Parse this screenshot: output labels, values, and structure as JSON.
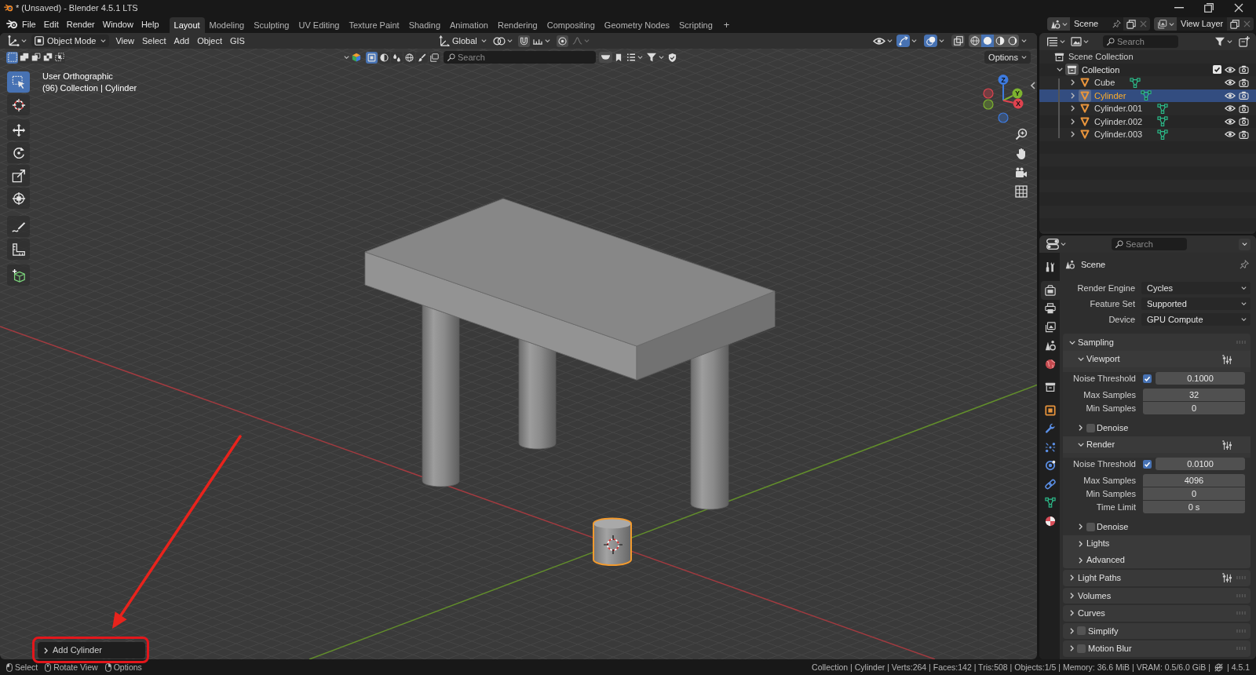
{
  "window": {
    "title": "* (Unsaved) - Blender 4.5.1 LTS"
  },
  "menu_bar": [
    "File",
    "Edit",
    "Render",
    "Window",
    "Help"
  ],
  "workspace_tabs": [
    {
      "label": "Layout",
      "selected": true
    },
    {
      "label": "Modeling",
      "selected": false
    },
    {
      "label": "Sculpting",
      "selected": false
    },
    {
      "label": "UV Editing",
      "selected": false
    },
    {
      "label": "Texture Paint",
      "selected": false
    },
    {
      "label": "Shading",
      "selected": false
    },
    {
      "label": "Animation",
      "selected": false
    },
    {
      "label": "Rendering",
      "selected": false
    },
    {
      "label": "Compositing",
      "selected": false
    },
    {
      "label": "Geometry Nodes",
      "selected": false
    },
    {
      "label": "Scripting",
      "selected": false
    }
  ],
  "add_workspace": "+",
  "scene_selector": {
    "value": "Scene"
  },
  "view_layer_selector": {
    "value": "View Layer"
  },
  "viewport": {
    "header": {
      "mode": "Object Mode",
      "menus": [
        "View",
        "Select",
        "Add",
        "Object",
        "GIS"
      ],
      "orientation": "Global",
      "snapping": {
        "on": false
      },
      "proportional_editing": {
        "on": false
      },
      "toggles": [
        {
          "kind": "gizmos",
          "on": true
        },
        {
          "kind": "overlays",
          "on": true
        },
        {
          "kind": "xray",
          "on": false
        }
      ],
      "shading": [
        {
          "kind": "wireframe",
          "selected": false
        },
        {
          "kind": "solid",
          "selected": true
        },
        {
          "kind": "material",
          "selected": false
        },
        {
          "kind": "rendered",
          "selected": false
        }
      ]
    },
    "tool_header": {
      "selection_modes": [
        {
          "kind": "set",
          "selected": true
        },
        {
          "kind": "extend",
          "selected": false
        },
        {
          "kind": "subtract",
          "selected": false
        },
        {
          "kind": "difference",
          "selected": false
        },
        {
          "kind": "intersect",
          "selected": false
        }
      ],
      "filters": [
        {
          "kind": "square",
          "selected": true
        },
        {
          "kind": "half_circle",
          "selected": false
        },
        {
          "kind": "drops",
          "selected": false
        },
        {
          "kind": "globe",
          "selected": false
        },
        {
          "kind": "brush",
          "selected": false
        },
        {
          "kind": "images",
          "selected": false
        }
      ],
      "search": {
        "placeholder": "Search"
      },
      "options": "Options"
    },
    "overlay_text": [
      "User Orthographic",
      "(96) Collection | Cylinder"
    ],
    "tools": [
      {
        "kind": "select_box",
        "selected": true
      },
      {
        "kind": "cursor",
        "selected": false
      },
      {
        "kind": "move",
        "selected": false
      },
      {
        "kind": "rotate",
        "selected": false
      },
      {
        "kind": "scale",
        "selected": false
      },
      {
        "kind": "transform",
        "selected": false
      },
      {
        "kind": "annotate",
        "selected": false
      },
      {
        "kind": "measure",
        "selected": false
      },
      {
        "kind": "add_cube",
        "selected": false
      }
    ],
    "gizmo_axes": [
      {
        "kind": "z",
        "label": "Z",
        "color": "#3d7be0"
      },
      {
        "kind": "y",
        "label": "Y",
        "color": "#7db32f"
      },
      {
        "kind": "x",
        "label": "X",
        "color": "#e0434f"
      }
    ],
    "redo_panel": {
      "label": "Add Cylinder",
      "expanded": false
    }
  },
  "outliner": {
    "search": {
      "placeholder": "Search"
    },
    "root": "Scene Collection",
    "collections": [
      {
        "name": "Collection",
        "expanded": true,
        "checked": true,
        "active": true,
        "children": [
          {
            "name": "Cube",
            "selected": false
          },
          {
            "name": "Cylinder",
            "selected": true
          },
          {
            "name": "Cylinder.001",
            "selected": false
          },
          {
            "name": "Cylinder.002",
            "selected": false
          },
          {
            "name": "Cylinder.003",
            "selected": false
          }
        ]
      }
    ]
  },
  "properties": {
    "search": {
      "placeholder": "Search"
    },
    "tabs": [
      {
        "kind": "tool",
        "selected": false
      },
      {
        "kind": "render",
        "selected": true
      },
      {
        "kind": "output",
        "selected": false
      },
      {
        "kind": "view_layer",
        "selected": false
      },
      {
        "kind": "scene",
        "selected": false
      },
      {
        "kind": "world",
        "selected": false
      },
      {
        "kind": "collection",
        "selected": false
      },
      {
        "kind": "object",
        "selected": false
      },
      {
        "kind": "modifiers",
        "selected": false
      },
      {
        "kind": "particles",
        "selected": false
      },
      {
        "kind": "physics",
        "selected": false
      },
      {
        "kind": "constraints",
        "selected": false
      },
      {
        "kind": "data",
        "selected": false
      },
      {
        "kind": "material",
        "selected": false
      }
    ],
    "context": "Scene",
    "fields": [
      {
        "label": "Render Engine",
        "value": "Cycles"
      },
      {
        "label": "Feature Set",
        "value": "Supported"
      },
      {
        "label": "Device",
        "value": "GPU Compute"
      }
    ],
    "panels": [
      {
        "title": "Sampling",
        "expanded": true,
        "children": [
          {
            "title": "Viewport",
            "expanded": true,
            "presets": true,
            "rows": [
              {
                "label": "Noise Threshold",
                "checked": true,
                "value": "0.1000"
              },
              {
                "label": "Max Samples",
                "value": "32"
              },
              {
                "label": "Min Samples",
                "value": "0"
              }
            ],
            "children": [
              {
                "title": "Denoise",
                "expanded": false,
                "checked": false
              }
            ]
          },
          {
            "title": "Render",
            "expanded": true,
            "presets": true,
            "rows": [
              {
                "label": "Noise Threshold",
                "checked": true,
                "value": "0.0100"
              },
              {
                "label": "Max Samples",
                "value": "4096"
              },
              {
                "label": "Min Samples",
                "value": "0"
              },
              {
                "label": "Time Limit",
                "value": "0 s"
              }
            ],
            "children": [
              {
                "title": "Denoise",
                "expanded": false,
                "checked": false
              }
            ]
          },
          {
            "title": "Lights",
            "expanded": false
          },
          {
            "title": "Advanced",
            "expanded": false
          }
        ]
      },
      {
        "title": "Light Paths",
        "expanded": false,
        "presets": true
      },
      {
        "title": "Volumes",
        "expanded": false
      },
      {
        "title": "Curves",
        "expanded": false
      },
      {
        "title": "Simplify",
        "expanded": false,
        "checked": false
      },
      {
        "title": "Motion Blur",
        "expanded": false,
        "checked": false
      }
    ]
  },
  "status_bar": {
    "hints": [
      {
        "kind": "left",
        "label": "Select"
      },
      {
        "kind": "middle",
        "label": "Rotate View"
      },
      {
        "kind": "right",
        "label": "Options"
      }
    ],
    "stats": "Collection | Cylinder | Verts:264 | Faces:142 | Tris:508 | Objects:1/5 | Memory: 36.6 MiB | VRAM: 0.5/6.0 GiB |",
    "version": "| 4.5.1"
  }
}
